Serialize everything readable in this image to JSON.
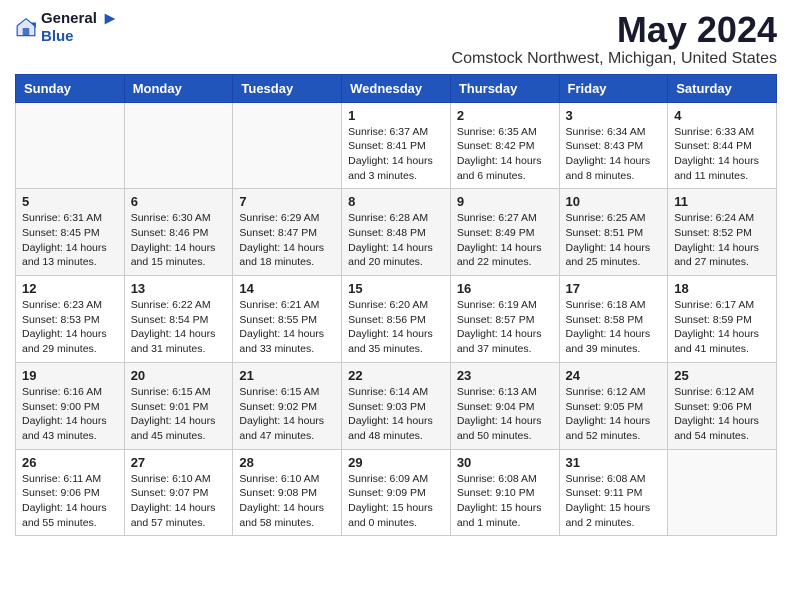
{
  "header": {
    "logo_general": "General",
    "logo_blue": "Blue",
    "month_title": "May 2024",
    "location": "Comstock Northwest, Michigan, United States"
  },
  "weekdays": [
    "Sunday",
    "Monday",
    "Tuesday",
    "Wednesday",
    "Thursday",
    "Friday",
    "Saturday"
  ],
  "weeks": [
    [
      {
        "day": "",
        "sunrise": "",
        "sunset": "",
        "daylight": ""
      },
      {
        "day": "",
        "sunrise": "",
        "sunset": "",
        "daylight": ""
      },
      {
        "day": "",
        "sunrise": "",
        "sunset": "",
        "daylight": ""
      },
      {
        "day": "1",
        "sunrise": "Sunrise: 6:37 AM",
        "sunset": "Sunset: 8:41 PM",
        "daylight": "Daylight: 14 hours and 3 minutes."
      },
      {
        "day": "2",
        "sunrise": "Sunrise: 6:35 AM",
        "sunset": "Sunset: 8:42 PM",
        "daylight": "Daylight: 14 hours and 6 minutes."
      },
      {
        "day": "3",
        "sunrise": "Sunrise: 6:34 AM",
        "sunset": "Sunset: 8:43 PM",
        "daylight": "Daylight: 14 hours and 8 minutes."
      },
      {
        "day": "4",
        "sunrise": "Sunrise: 6:33 AM",
        "sunset": "Sunset: 8:44 PM",
        "daylight": "Daylight: 14 hours and 11 minutes."
      }
    ],
    [
      {
        "day": "5",
        "sunrise": "Sunrise: 6:31 AM",
        "sunset": "Sunset: 8:45 PM",
        "daylight": "Daylight: 14 hours and 13 minutes."
      },
      {
        "day": "6",
        "sunrise": "Sunrise: 6:30 AM",
        "sunset": "Sunset: 8:46 PM",
        "daylight": "Daylight: 14 hours and 15 minutes."
      },
      {
        "day": "7",
        "sunrise": "Sunrise: 6:29 AM",
        "sunset": "Sunset: 8:47 PM",
        "daylight": "Daylight: 14 hours and 18 minutes."
      },
      {
        "day": "8",
        "sunrise": "Sunrise: 6:28 AM",
        "sunset": "Sunset: 8:48 PM",
        "daylight": "Daylight: 14 hours and 20 minutes."
      },
      {
        "day": "9",
        "sunrise": "Sunrise: 6:27 AM",
        "sunset": "Sunset: 8:49 PM",
        "daylight": "Daylight: 14 hours and 22 minutes."
      },
      {
        "day": "10",
        "sunrise": "Sunrise: 6:25 AM",
        "sunset": "Sunset: 8:51 PM",
        "daylight": "Daylight: 14 hours and 25 minutes."
      },
      {
        "day": "11",
        "sunrise": "Sunrise: 6:24 AM",
        "sunset": "Sunset: 8:52 PM",
        "daylight": "Daylight: 14 hours and 27 minutes."
      }
    ],
    [
      {
        "day": "12",
        "sunrise": "Sunrise: 6:23 AM",
        "sunset": "Sunset: 8:53 PM",
        "daylight": "Daylight: 14 hours and 29 minutes."
      },
      {
        "day": "13",
        "sunrise": "Sunrise: 6:22 AM",
        "sunset": "Sunset: 8:54 PM",
        "daylight": "Daylight: 14 hours and 31 minutes."
      },
      {
        "day": "14",
        "sunrise": "Sunrise: 6:21 AM",
        "sunset": "Sunset: 8:55 PM",
        "daylight": "Daylight: 14 hours and 33 minutes."
      },
      {
        "day": "15",
        "sunrise": "Sunrise: 6:20 AM",
        "sunset": "Sunset: 8:56 PM",
        "daylight": "Daylight: 14 hours and 35 minutes."
      },
      {
        "day": "16",
        "sunrise": "Sunrise: 6:19 AM",
        "sunset": "Sunset: 8:57 PM",
        "daylight": "Daylight: 14 hours and 37 minutes."
      },
      {
        "day": "17",
        "sunrise": "Sunrise: 6:18 AM",
        "sunset": "Sunset: 8:58 PM",
        "daylight": "Daylight: 14 hours and 39 minutes."
      },
      {
        "day": "18",
        "sunrise": "Sunrise: 6:17 AM",
        "sunset": "Sunset: 8:59 PM",
        "daylight": "Daylight: 14 hours and 41 minutes."
      }
    ],
    [
      {
        "day": "19",
        "sunrise": "Sunrise: 6:16 AM",
        "sunset": "Sunset: 9:00 PM",
        "daylight": "Daylight: 14 hours and 43 minutes."
      },
      {
        "day": "20",
        "sunrise": "Sunrise: 6:15 AM",
        "sunset": "Sunset: 9:01 PM",
        "daylight": "Daylight: 14 hours and 45 minutes."
      },
      {
        "day": "21",
        "sunrise": "Sunrise: 6:15 AM",
        "sunset": "Sunset: 9:02 PM",
        "daylight": "Daylight: 14 hours and 47 minutes."
      },
      {
        "day": "22",
        "sunrise": "Sunrise: 6:14 AM",
        "sunset": "Sunset: 9:03 PM",
        "daylight": "Daylight: 14 hours and 48 minutes."
      },
      {
        "day": "23",
        "sunrise": "Sunrise: 6:13 AM",
        "sunset": "Sunset: 9:04 PM",
        "daylight": "Daylight: 14 hours and 50 minutes."
      },
      {
        "day": "24",
        "sunrise": "Sunrise: 6:12 AM",
        "sunset": "Sunset: 9:05 PM",
        "daylight": "Daylight: 14 hours and 52 minutes."
      },
      {
        "day": "25",
        "sunrise": "Sunrise: 6:12 AM",
        "sunset": "Sunset: 9:06 PM",
        "daylight": "Daylight: 14 hours and 54 minutes."
      }
    ],
    [
      {
        "day": "26",
        "sunrise": "Sunrise: 6:11 AM",
        "sunset": "Sunset: 9:06 PM",
        "daylight": "Daylight: 14 hours and 55 minutes."
      },
      {
        "day": "27",
        "sunrise": "Sunrise: 6:10 AM",
        "sunset": "Sunset: 9:07 PM",
        "daylight": "Daylight: 14 hours and 57 minutes."
      },
      {
        "day": "28",
        "sunrise": "Sunrise: 6:10 AM",
        "sunset": "Sunset: 9:08 PM",
        "daylight": "Daylight: 14 hours and 58 minutes."
      },
      {
        "day": "29",
        "sunrise": "Sunrise: 6:09 AM",
        "sunset": "Sunset: 9:09 PM",
        "daylight": "Daylight: 15 hours and 0 minutes."
      },
      {
        "day": "30",
        "sunrise": "Sunrise: 6:08 AM",
        "sunset": "Sunset: 9:10 PM",
        "daylight": "Daylight: 15 hours and 1 minute."
      },
      {
        "day": "31",
        "sunrise": "Sunrise: 6:08 AM",
        "sunset": "Sunset: 9:11 PM",
        "daylight": "Daylight: 15 hours and 2 minutes."
      },
      {
        "day": "",
        "sunrise": "",
        "sunset": "",
        "daylight": ""
      }
    ]
  ]
}
